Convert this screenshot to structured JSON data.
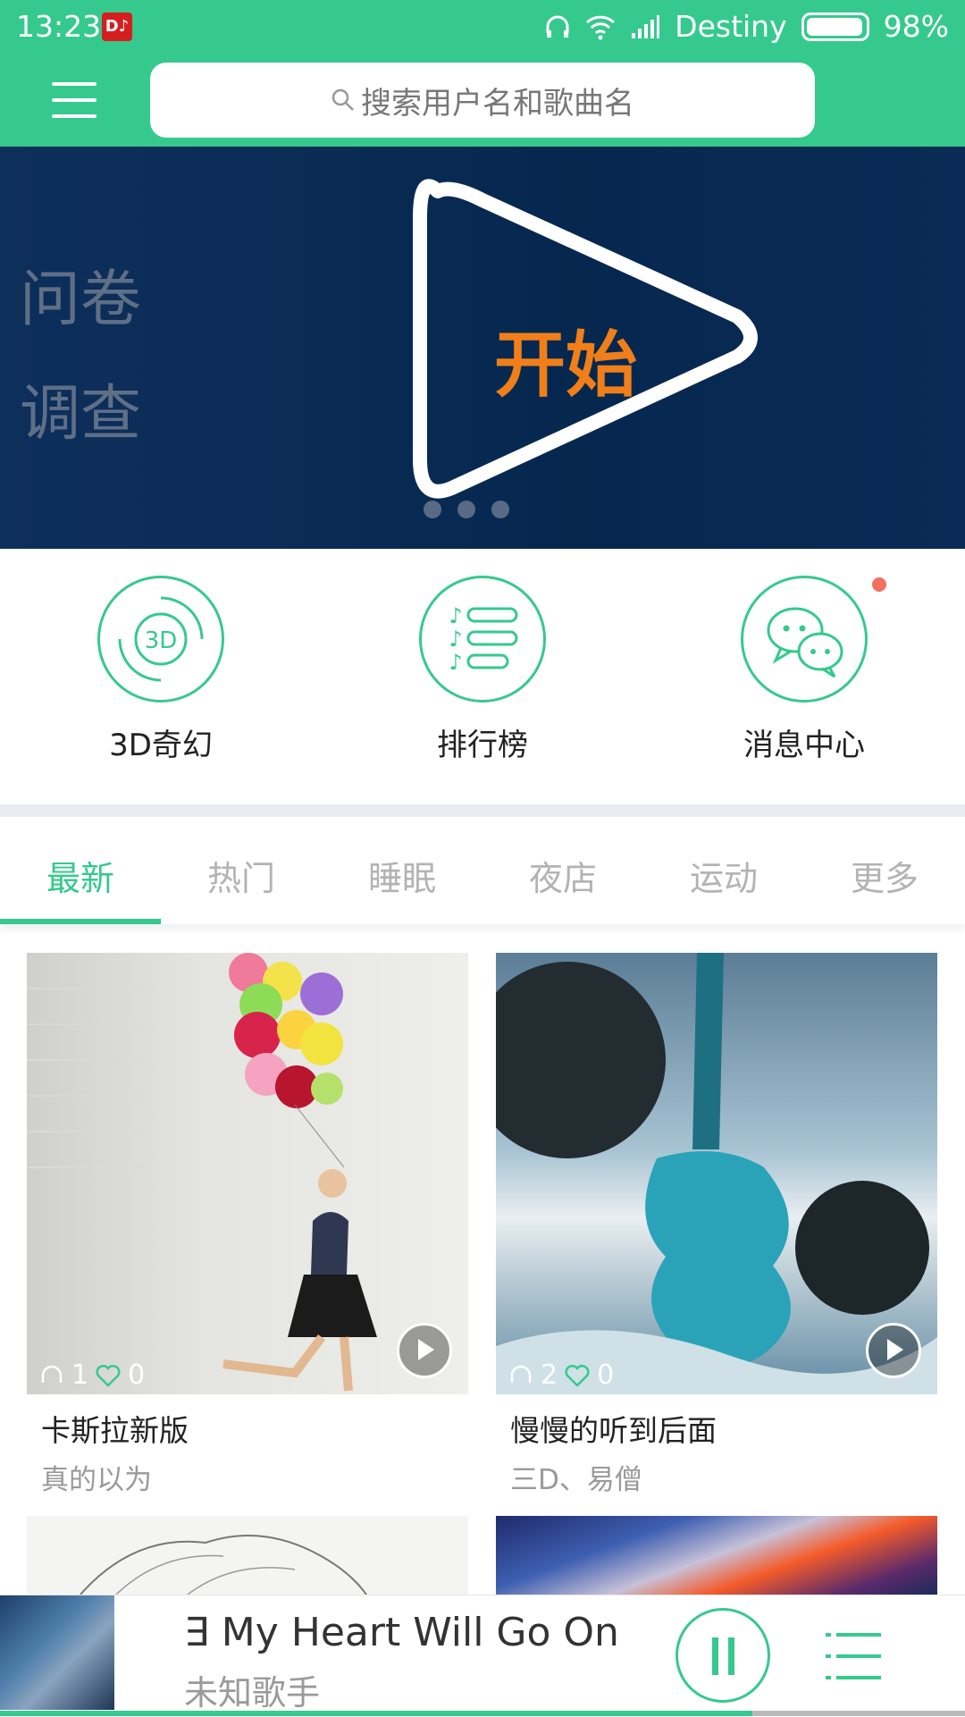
{
  "status_bar": {
    "time": "13:23",
    "app_badge": "D♪",
    "carrier": "Destiny",
    "battery": "98%"
  },
  "search": {
    "placeholder": "搜索用户名和歌曲名"
  },
  "banner": {
    "side_line1": "问卷",
    "side_line2": "调查",
    "button_text": "开始",
    "page_count": 3
  },
  "quick_actions": [
    {
      "label": "3D奇幻",
      "icon": "3d-sound-icon"
    },
    {
      "label": "排行榜",
      "icon": "ranking-list-icon"
    },
    {
      "label": "消息中心",
      "icon": "message-center-icon",
      "unread": true
    }
  ],
  "tabs": [
    "最新",
    "热门",
    "睡眠",
    "夜店",
    "运动",
    "更多"
  ],
  "active_tab": 0,
  "cards": [
    {
      "title": "卡斯拉新版",
      "subtitle": "真的以为",
      "plays": "1",
      "likes": "0"
    },
    {
      "title": "慢慢的听到后面",
      "subtitle": "三D、易僧",
      "plays": "2",
      "likes": "0"
    }
  ],
  "now_playing": {
    "song": "∃ My Heart Will Go On",
    "artist": "未知歌手",
    "progress": 0.78
  },
  "colors": {
    "accent": "#35c98e",
    "banner_bg": "#0b2c57",
    "start_text": "#f07f1a",
    "badge_red": "#f2705f"
  }
}
